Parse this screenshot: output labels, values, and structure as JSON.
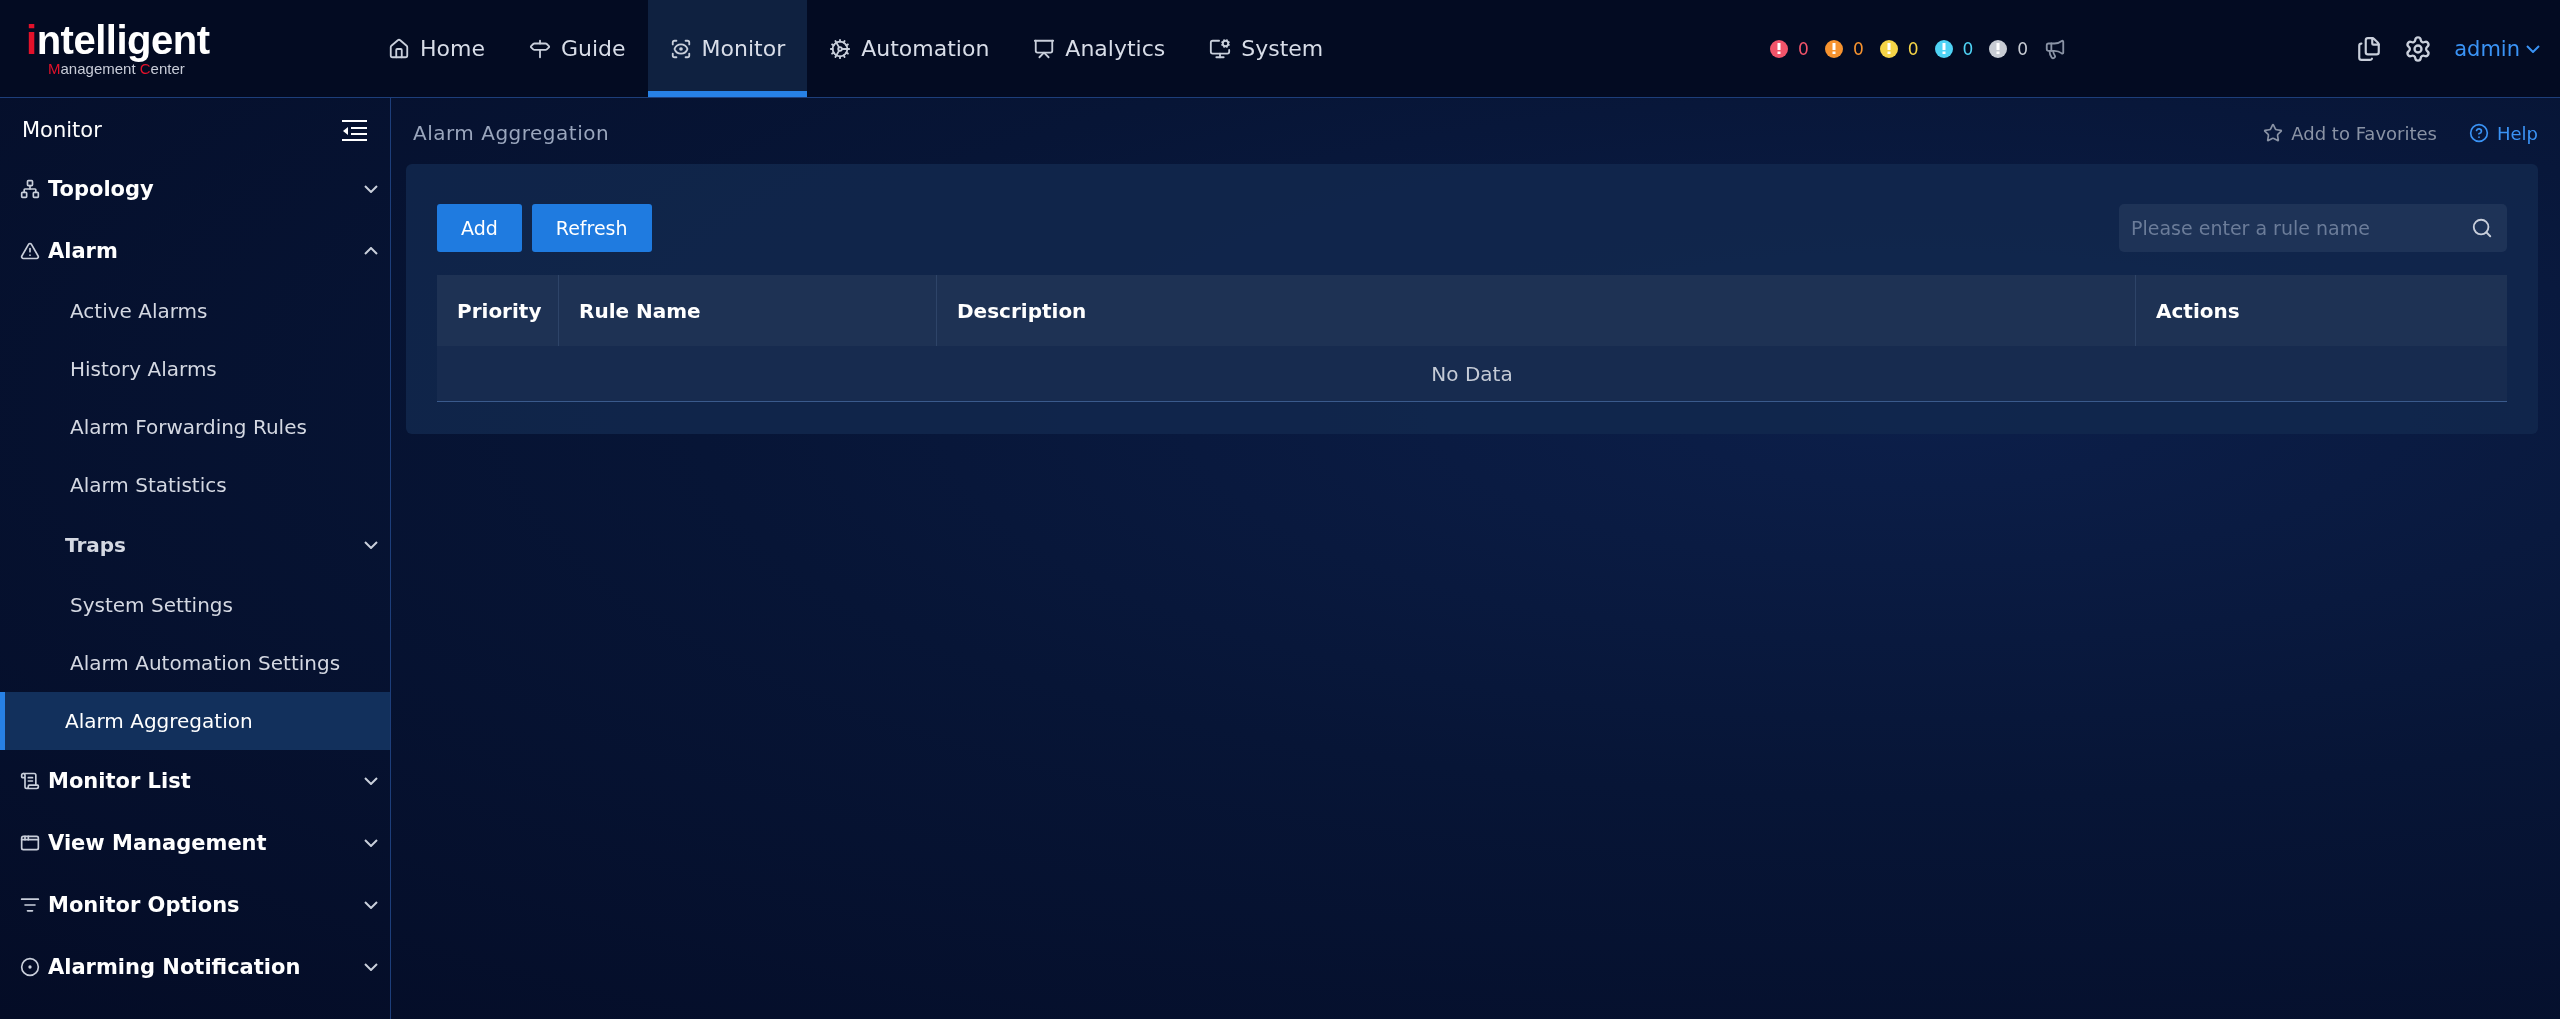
{
  "logo": {
    "word": "intelligent",
    "subtitle": "Management Center"
  },
  "nav": [
    {
      "label": "Home",
      "selected": false
    },
    {
      "label": "Guide",
      "selected": false
    },
    {
      "label": "Monitor",
      "selected": true
    },
    {
      "label": "Automation",
      "selected": false
    },
    {
      "label": "Analytics",
      "selected": false
    },
    {
      "label": "System",
      "selected": false
    }
  ],
  "alarm_counts": [
    {
      "count": "0",
      "color": "#f2546a"
    },
    {
      "count": "0",
      "color": "#f7932f"
    },
    {
      "count": "0",
      "color": "#f5d447"
    },
    {
      "count": "0",
      "color": "#4fd3f5"
    },
    {
      "count": "0",
      "color": "#c8ccd4"
    }
  ],
  "user": "admin",
  "sidebar": {
    "title": "Monitor",
    "items": [
      {
        "label": "Topology",
        "kind": "group",
        "expanded": false
      },
      {
        "label": "Alarm",
        "kind": "group",
        "expanded": true,
        "children": [
          {
            "label": "Active Alarms",
            "kind": "link",
            "selected": false
          },
          {
            "label": "History Alarms",
            "kind": "link",
            "selected": false
          },
          {
            "label": "Alarm Forwarding Rules",
            "kind": "link",
            "selected": false
          },
          {
            "label": "Alarm Statistics",
            "kind": "link",
            "selected": false
          },
          {
            "label": "Traps",
            "kind": "group",
            "expanded": false
          },
          {
            "label": "System Settings",
            "kind": "link",
            "selected": false
          },
          {
            "label": "Alarm Automation Settings",
            "kind": "link",
            "selected": false
          },
          {
            "label": "Alarm Aggregation",
            "kind": "link",
            "selected": true
          }
        ]
      },
      {
        "label": "Monitor List",
        "kind": "group",
        "expanded": false
      },
      {
        "label": "View Management",
        "kind": "group",
        "expanded": false
      },
      {
        "label": "Monitor Options",
        "kind": "group",
        "expanded": false
      },
      {
        "label": "Alarming Notification",
        "kind": "group",
        "expanded": false
      }
    ]
  },
  "breadcrumb": "Alarm Aggregation",
  "favorites": "Add to Favorites",
  "help": "Help",
  "buttons": [
    "Add",
    "Refresh"
  ],
  "search": {
    "placeholder": "Please enter a rule name"
  },
  "table": {
    "columns": [
      "Priority",
      "Rule Name",
      "Description",
      "Actions"
    ],
    "empty_text": "No Data"
  }
}
